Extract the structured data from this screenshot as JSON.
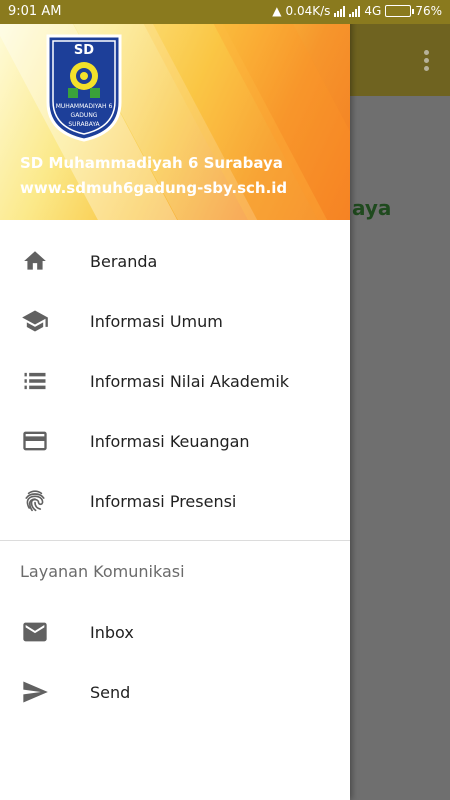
{
  "status_bar": {
    "time": "9:01 AM",
    "network_speed": "0.04K/s",
    "network_type": "4G",
    "battery": "76%",
    "battery_level": 0.76
  },
  "background_app": {
    "partial_title": "aya",
    "toolbar_color": "#6f6320"
  },
  "drawer": {
    "header": {
      "logo_text_top": "SD",
      "logo_text_bottom_1": "MUHAMMADIYAH 6",
      "logo_text_bottom_2": "GADUNG",
      "logo_text_bottom_3": "SURABAYA",
      "school_name": "SD Muhammadiyah 6 Surabaya",
      "school_url": "www.sdmuh6gadung-sby.sch.id"
    },
    "menu_items": [
      {
        "label": "Beranda",
        "icon": "home-icon"
      },
      {
        "label": "Informasi Umum",
        "icon": "school-icon"
      },
      {
        "label": "Informasi Nilai Akademik",
        "icon": "list-icon"
      },
      {
        "label": "Informasi Keuangan",
        "icon": "credit-card-icon"
      },
      {
        "label": "Informasi Presensi",
        "icon": "fingerprint-icon"
      }
    ],
    "section_title": "Layanan Komunikasi",
    "comm_items": [
      {
        "label": "Inbox",
        "icon": "mail-icon"
      },
      {
        "label": "Send",
        "icon": "send-icon"
      }
    ]
  },
  "colors": {
    "icon": "#616161",
    "logo_blue": "#1d3f99"
  }
}
